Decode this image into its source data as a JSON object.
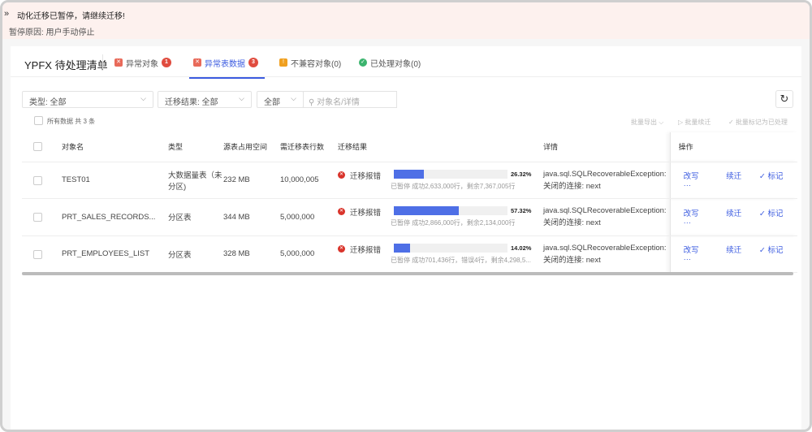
{
  "banner": {
    "title": "动化迁移已暂停，请继续迁移!",
    "reason": "暂停原因: 用户手动停止"
  },
  "header": {
    "title": "YPFX 待处理清单",
    "tabs": [
      {
        "label": "异常对象",
        "badge": "1",
        "color": "#e04c3f"
      },
      {
        "label": "异常表数据",
        "badge": "3",
        "color": "#e04c3f"
      },
      {
        "label": "不兼容对象(0)",
        "color": "#f0a020"
      },
      {
        "label": "已处理对象(0)",
        "color": "#3bb46e"
      }
    ]
  },
  "filters": {
    "type": "类型:  全部",
    "result": "迁移结果:  全部",
    "scope": "全部",
    "search_placeholder": "对象名/详情"
  },
  "summary": "所有数据 共 3 条",
  "batch": {
    "export": "批量导出",
    "resume": "批量续迁",
    "mark": "批量标记为已处理"
  },
  "columns": [
    "对象名",
    "类型",
    "源表占用空间",
    "需迁移表行数",
    "迁移结果",
    "详情",
    "操作"
  ],
  "rows": [
    {
      "name": "TEST01",
      "type": "大数据量表（未分区)",
      "space": "232 MB",
      "rowcount": "10,000,005",
      "status": "迁移报错",
      "progress": 26.32,
      "pct": "26.32%",
      "sub": "已暂停 成功2,633,000行，剩余7,367,005行",
      "detail": "java.sql.SQLRecoverableException: 关闭的连接: next"
    },
    {
      "name": "PRT_SALES_RECORDS...",
      "type": "分区表",
      "space": "344 MB",
      "rowcount": "5,000,000",
      "status": "迁移报错",
      "progress": 57.32,
      "pct": "57.32%",
      "sub": "已暂停 成功2,866,000行，剩余2,134,000行",
      "detail": "java.sql.SQLRecoverableException: 关闭的连接: next"
    },
    {
      "name": "PRT_EMPLOYEES_LIST",
      "type": "分区表",
      "space": "328 MB",
      "rowcount": "5,000,000",
      "status": "迁移报错",
      "progress": 14.02,
      "pct": "14.02%",
      "sub": "已暂停 成功701,436行，错误4行，剩余4,298,5...",
      "detail": "java.sql.SQLRecoverableException: 关闭的连接: next"
    }
  ],
  "actions": {
    "rewrite": "改写",
    "resume": "续迁",
    "mark": "标记",
    "more": "···"
  }
}
